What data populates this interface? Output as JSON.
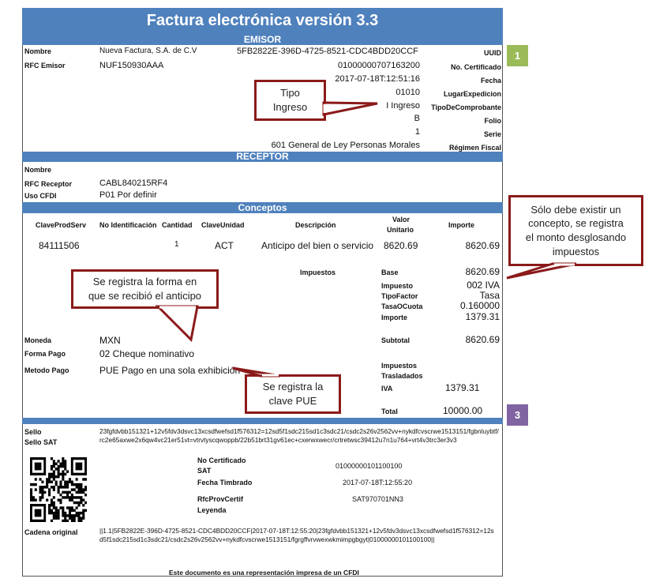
{
  "title": "Factura electrónica versión 3.3",
  "sections": {
    "emisor": "EMISOR",
    "receptor": "RECEPTOR",
    "conceptos": "Conceptos"
  },
  "emisor": {
    "nombre_label": "Nombre",
    "nombre_value": "Nueva Factura, S.A. de C.V",
    "rfc_label": "RFC Emisor",
    "rfc_value": "NUF150930AAA",
    "uuid_value": "5FB2822E-396D-4725-8521-CDC4BDD20CCF",
    "uuid_label": "UUID",
    "cert_value": "01000000707163200",
    "cert_label": "No. Certificado",
    "fecha_value": "2017-07-18T:12:51:16",
    "fecha_label": "Fecha",
    "lugar_value": "01010",
    "lugar_label": "LugarExpedicion",
    "tipo_value": "I Ingreso",
    "tipo_label": "TipoDeComprobante",
    "folio_value": "B",
    "folio_label": "Folio",
    "serie_value": "1",
    "serie_label": "Serie",
    "regimen_value": "601 General de Ley Personas Morales",
    "regimen_label": "Régimen Fiscal"
  },
  "receptor": {
    "nombre_label": "Nombre",
    "rfc_label": "RFC Receptor",
    "rfc_value": "CABL840215RF4",
    "uso_label": "Uso CFDI",
    "uso_value": "P01 Por definir"
  },
  "conceptos": {
    "headers": {
      "clave_prod": "ClaveProdServ",
      "no_id": "No Identificación",
      "cantidad": "Cantidad",
      "clave_unidad": "ClaveUnidad",
      "descripcion": "Descripción",
      "valor_unitario_1": "Valor",
      "valor_unitario_2": "Unitario",
      "importe": "Importe"
    },
    "row": {
      "clave_prod": "84111506",
      "cantidad": "1",
      "clave_unidad": "ACT",
      "descripcion": "Anticipo del bien o servicio",
      "valor_unitario": "8620.69",
      "importe": "8620.69"
    },
    "impuestos_label": "Impuestos",
    "taxes": [
      {
        "label": "Base",
        "value": "8620.69"
      },
      {
        "label": "Impuesto",
        "value": "002 IVA"
      },
      {
        "label": "TipoFactor",
        "value": "Tasa"
      },
      {
        "label": "TasaOCuota",
        "value": "0.160000"
      },
      {
        "label": "Importe",
        "value": "1379.31"
      }
    ],
    "moneda_label": "Moneda",
    "moneda_value": "MXN",
    "forma_label": "Forma Pago",
    "forma_value": "02 Cheque nominativo",
    "metodo_label": "Metodo Pago",
    "metodo_value": "PUE Pago en una sola exhibición",
    "subtotal_label": "Subtotal",
    "subtotal_value": "8620.69",
    "trasl_label_1": "Impuestos",
    "trasl_label_2": "Trasladados",
    "iva_label": "IVA",
    "iva_value": "1379.31",
    "total_label": "Total",
    "total_value": "10000.00"
  },
  "sello": {
    "sello_label": "Sello",
    "sello_sat_label": "Sello SAT",
    "sello_text": "23fgfdvbb151321+12v5fdv3dsvc13xcsdfwefsd1f576312=12sd5f1sdc215sd1c3sdc21/csdc2s26v2562vv+nykdfcvscrwe1513151/fgbnluybtf/rc2e65axwe2x6qw4vc21er51vt=vtrvtyscqwoppb/22b51brt31gv61ec+cxerwxwecr/crtretwsc39412u7n1u764+vrt4v3trc3er3v3",
    "no_cert_sat_label_1": "No Certificado",
    "no_cert_sat_label_2": "SAT",
    "no_cert_sat_value": "01000000101100100",
    "fecha_timbrado_label": "Fecha Timbrado",
    "fecha_timbrado_value": "2017-07-18T:12:55:20",
    "rfc_prov_label": "RfcProvCertif",
    "rfc_prov_value": "SAT970701NN3",
    "leyenda_label": "Leyenda",
    "cadena_label": "Cadena original",
    "cadena_text": "||1.1|5FB2822E-396D-4725-8521-CDC4BDD20CCF|2017-07-18T:12:55:20|23fgfdvbb151321+12v5fdv3dsvc13xcsdfwefsd1f576312=12sd5f1sdc215sd1c3sdc21/csdc2s26v2562vv+nykdfcvscrwe1513151/fgrgffvrvwexwkmimpgbgyt|01000000101100100||",
    "footer": "Este documento es una representación impresa de un CFDI"
  },
  "callouts": {
    "tipo": [
      "Tipo",
      "Ingreso"
    ],
    "forma": [
      "Se registra la forma en",
      "que se recibió el anticipo"
    ],
    "pue": [
      "Se registra la",
      "clave PUE"
    ],
    "concepto": [
      "Sólo debe existir un",
      "concepto, se registra",
      "el monto desglosando",
      "impuestos"
    ]
  },
  "badges": {
    "b1": "1",
    "b3": "3"
  },
  "colors": {
    "header_bar": "#4f81bd",
    "callout_border": "#8b1a1a",
    "badge_green": "#9bbb59",
    "badge_purple": "#8064a2"
  }
}
